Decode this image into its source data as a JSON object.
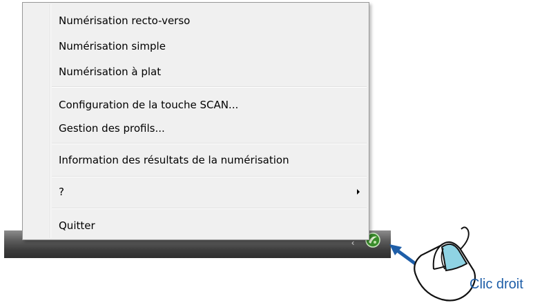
{
  "menu": {
    "items": [
      {
        "label": "Numérisation recto-verso"
      },
      {
        "label": "Numérisation simple"
      },
      {
        "label": "Numérisation à plat"
      },
      {
        "label": "Configuration de la touche SCAN..."
      },
      {
        "label": "Gestion des profils..."
      },
      {
        "label": "Information des résultats de la numérisation"
      },
      {
        "label": "?",
        "has_submenu": true
      },
      {
        "label": "Quitter"
      }
    ]
  },
  "taskbar": {
    "chevron": "‹",
    "tray_icon": "scanner-tray-icon"
  },
  "annotation": {
    "label": "Clic droit",
    "label_color": "#1e5ea8",
    "highlight_color": "#8fd3e3",
    "arrow_color": "#1e5ea8"
  }
}
